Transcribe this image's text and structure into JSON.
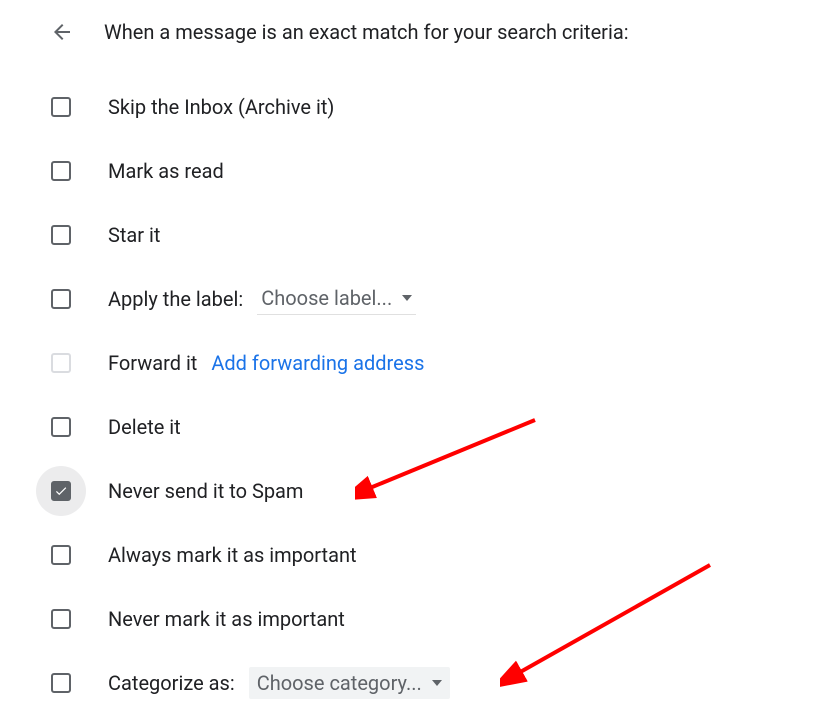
{
  "header": {
    "title": "When a message is an exact match for your search criteria:"
  },
  "options": {
    "skip_inbox": "Skip the Inbox (Archive it)",
    "mark_read": "Mark as read",
    "star": "Star it",
    "apply_label": "Apply the label:",
    "choose_label": "Choose label...",
    "forward": "Forward it",
    "add_forward": "Add forwarding address",
    "delete": "Delete it",
    "never_spam": "Never send it to Spam",
    "always_important": "Always mark it as important",
    "never_important": "Never mark it as important",
    "categorize": "Categorize as:",
    "choose_category": "Choose category..."
  },
  "state": {
    "checked": "never_spam"
  },
  "colors": {
    "link": "#1a73e8",
    "text": "#202124",
    "muted": "#5f6368",
    "arrow": "#ff0000"
  }
}
